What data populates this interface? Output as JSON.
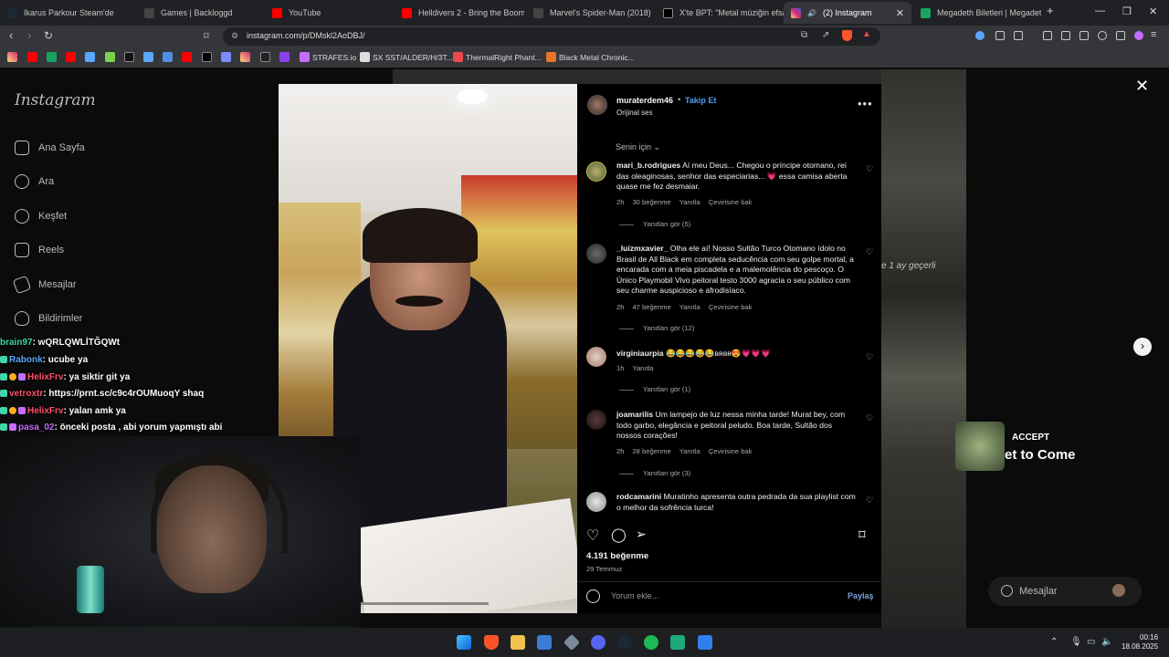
{
  "browser": {
    "tabs": [
      {
        "label": "Ikarus Parkour Steam'de",
        "color": "#1b2838"
      },
      {
        "label": "Games | Backloggd",
        "color": "#222222"
      },
      {
        "label": "YouTube",
        "color": "#ff0000"
      },
      {
        "label": "Helldivers 2 - Bring the Boom",
        "color": "#ff0000"
      },
      {
        "label": "Marvel's Spider-Man (2018)",
        "color": "#222222"
      },
      {
        "label": "X'te BPT: \"Metal müziğin efsan",
        "color": "#000000"
      },
      {
        "label": "(2) Instagram",
        "color": "#d6249f"
      },
      {
        "label": "Megadeth Biletleri | Megadeth",
        "color": "#1aa260"
      }
    ],
    "url": "instagram.com/p/DMskl2AoDBJ/",
    "bookmarks": [
      "STRAFES.io",
      "SX SST/ALDER/H/3T...",
      "ThermalRight Phant...",
      "Black Metal Chronic..."
    ]
  },
  "sidebar": {
    "logo": "Instagram",
    "items": [
      "Ana Sayfa",
      "Ara",
      "Keşfet",
      "Reels",
      "Mesajlar",
      "Bildirimler"
    ]
  },
  "post": {
    "author": "muraterdem46",
    "follow_label": "Takip Et",
    "audio": "Orijinal ses",
    "sort_label": "Senin için",
    "likes": "4.191 beğenme",
    "date": "29 Temmuz",
    "comment_placeholder": "Yorum ekle...",
    "share_label": "Paylaş"
  },
  "comments": [
    {
      "user": "mari_b.rodrigues",
      "text": "Aí meu Deus... Chegou o príncipe otomano, rei das oleaginosas, senhor das especiarias... 💗 essa camisa aberta quase me fez desmaiar.",
      "time": "2h",
      "likes": "30 beğenme",
      "reply": "Yanıtla",
      "translate": "Çevirisine bak",
      "replies": "Yanıtları gör (5)"
    },
    {
      "user": "_luizmxavier_",
      "text": "Olha ele aí! Nosso Sultão Turco Otomano ídolo no Brasil de All Black em completa seducência com seu golpe mortal, a encarada com a meia piscadela e a malemolência do pescoço. O Único Playmobil Vivo peitoral testo 3000 agracia o seu público com seu charme auspicioso e afrodisíaco.",
      "time": "2h",
      "likes": "47 beğenme",
      "reply": "Yanıtla",
      "translate": "Çevirisine bak",
      "replies": "Yanıtları gör (12)"
    },
    {
      "user": "virginiaurpia",
      "text": "😂😂😂😂😂ʙʀʙʀ😍💗💗💗",
      "time": "1h",
      "likes": "",
      "reply": "Yanıtla",
      "translate": "",
      "replies": "Yanıtları gör (1)"
    },
    {
      "user": "joamarilis",
      "text": "Um lampejo de luz nessa minha tarde! Murat bey, com todo garbo, elegância e peitoral peludo. Boa tarde, Sultão dos nossos corações!",
      "time": "2h",
      "likes": "28 beğenme",
      "reply": "Yanıtla",
      "translate": "Çevirisine bak",
      "replies": "Yanıtları gör (3)"
    },
    {
      "user": "rodcamarini",
      "text": "Muratinho apresenta outra pedrada da sua playlist com o melhor da sofrência turca!",
      "time": "",
      "likes": "",
      "reply": "",
      "translate": "",
      "replies": ""
    }
  ],
  "chat": [
    {
      "user": "brain97",
      "msg": ": wQRLQWLİTĞQWt",
      "color": "#3fd6a8"
    },
    {
      "user": "Rabonk",
      "msg": ": ucube ya",
      "color": "#5aa7ff"
    },
    {
      "user": "HelixFrv",
      "msg": ": ya siktir git ya",
      "color": "#ff4f6a"
    },
    {
      "user": "vetroxtr",
      "msg": ": https://prnt.sc/c9c4rOUMuoqY shaq",
      "color": "#ff4f6a"
    },
    {
      "user": "HelixFrv",
      "msg": ": yalan amk ya",
      "color": "#ff4f6a"
    },
    {
      "user": "pasa_02",
      "msg": ": önceki posta , abi yorum yapmıştı abi",
      "color": "#c46dff"
    }
  ],
  "alert": {
    "title": "ACCEPT",
    "subtitle": "et to Come"
  },
  "dm": {
    "label": "Mesajlar"
  },
  "bg_text": "e 1 ay geçerli",
  "clock": {
    "time": "00:16",
    "date": "18.08.2025"
  }
}
